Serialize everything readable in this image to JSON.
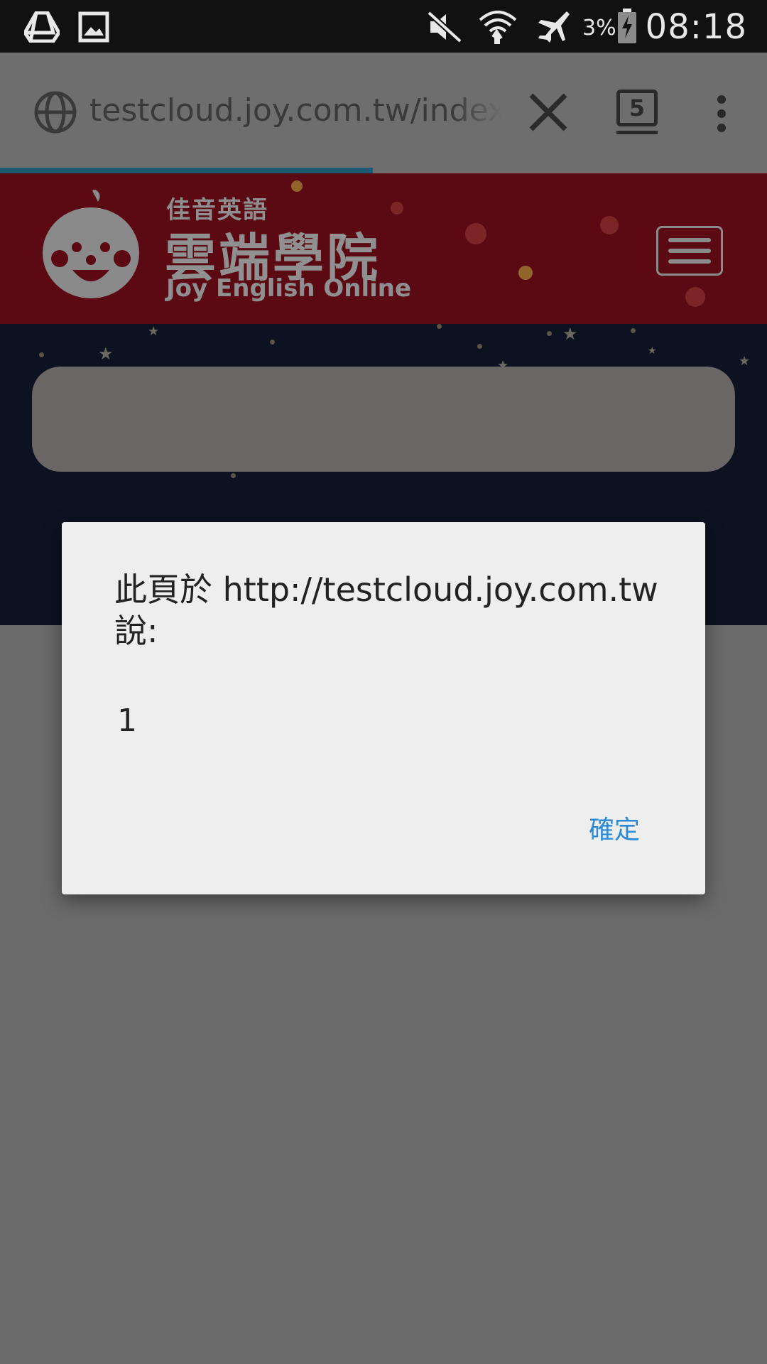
{
  "status_bar": {
    "left_icons": [
      "drive-icon",
      "gallery-icon"
    ],
    "right_icons": [
      "mute-icon",
      "wifi-icon",
      "airplane-mode-icon",
      "battery-charging-icon"
    ],
    "battery_percent": "3%",
    "time": "08:18"
  },
  "browser": {
    "url": "testcloud.joy.com.tw/index.php",
    "tab_count": "5",
    "load_progress": 0.6
  },
  "site": {
    "brand_small": "佳音英語",
    "brand_big": "雲端學院",
    "brand_en": "Joy English Online"
  },
  "dialog": {
    "title": "此頁於 http://testcloud.joy.com.tw 說:",
    "message": "1",
    "ok_label": "確定"
  },
  "colors": {
    "accent": "#2b8ad8",
    "header": "#5b0a13",
    "night": "#0c1220"
  }
}
